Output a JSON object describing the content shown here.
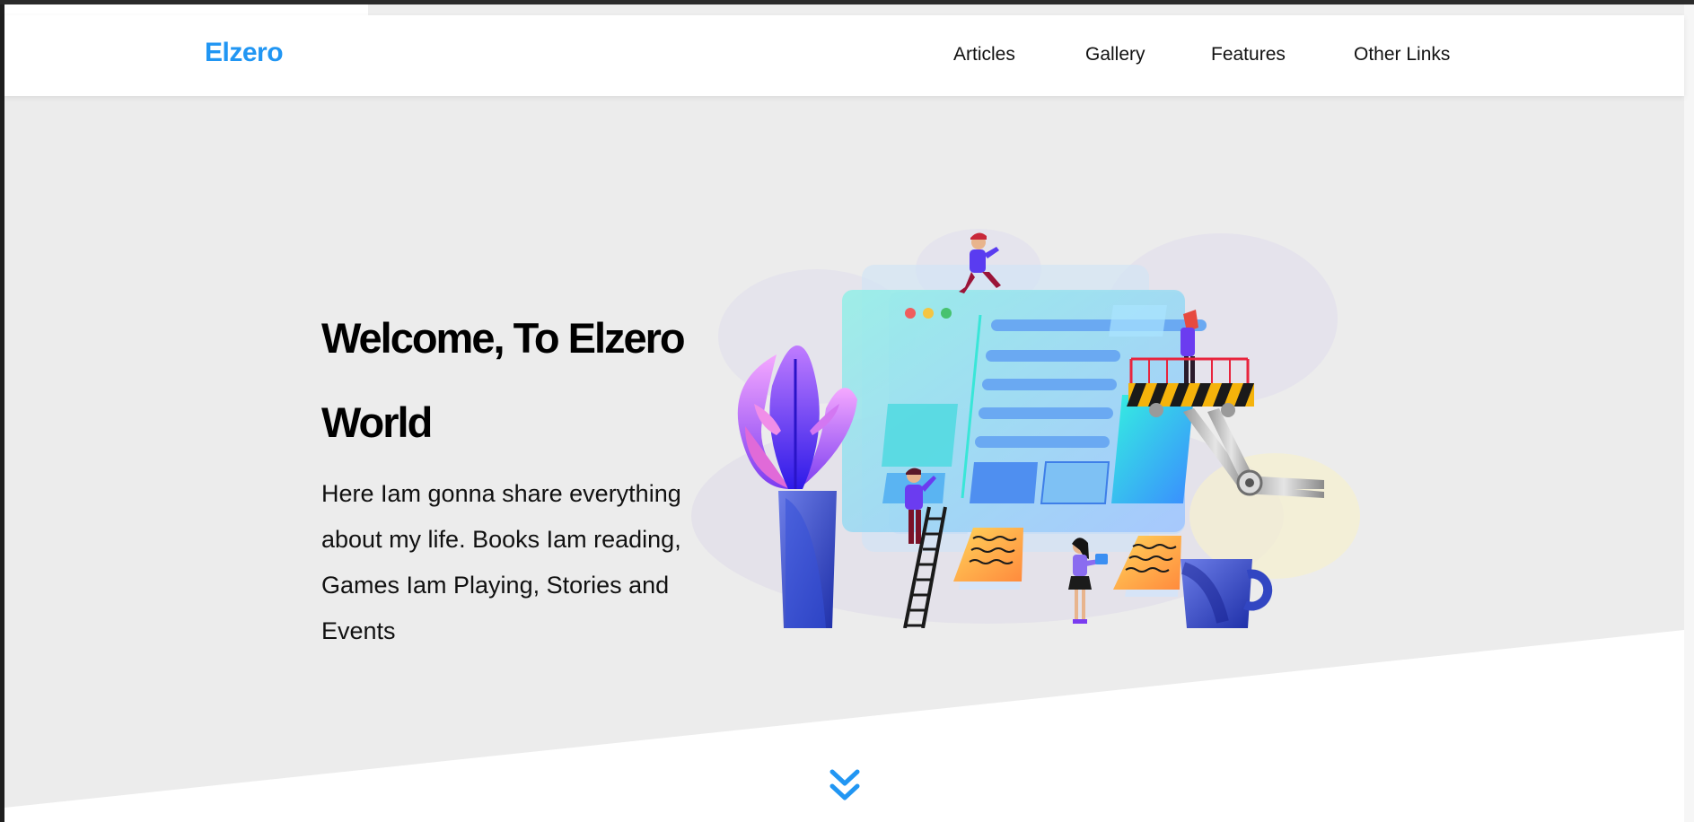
{
  "header": {
    "logo": "Elzero",
    "nav": {
      "articles": "Articles",
      "gallery": "Gallery",
      "features": "Features",
      "other_links": "Other Links"
    }
  },
  "hero": {
    "title": "Welcome, To Elzero World",
    "text": "Here Iam gonna share everything about my life. Books Iam reading, Games Iam Playing, Stories and Events",
    "illustration_icon": "website-building-illustration",
    "scroll_icon": "double-chevron-down-icon"
  },
  "colors": {
    "accent": "#2196f3",
    "hero_background": "#ececec",
    "page_background": "#ffffff"
  }
}
